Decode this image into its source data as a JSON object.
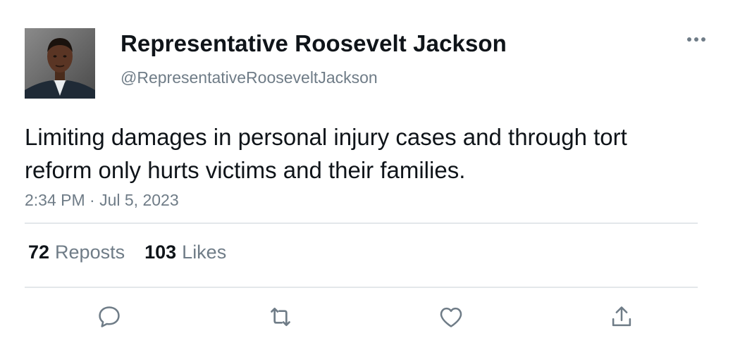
{
  "author": {
    "display_name": "Representative Roosevelt Jackson",
    "handle": "@RepresentativeRooseveltJackson"
  },
  "tweet": {
    "text": "Limiting damages in personal injury cases and through tort reform only hurts victims and their families.",
    "timestamp": "2:34 PM · Jul 5, 2023"
  },
  "stats": {
    "reposts": {
      "count": "72",
      "label": "Reposts"
    },
    "likes": {
      "count": "103",
      "label": "Likes"
    }
  },
  "actions": {
    "reply": "chat-bubble-icon",
    "repost": "retweet-arrows-icon",
    "like": "heart-icon",
    "share": "share-upload-icon"
  },
  "colors": {
    "text": "#0f1419",
    "secondary": "#6f7c87",
    "divider": "#e3e7ea"
  }
}
